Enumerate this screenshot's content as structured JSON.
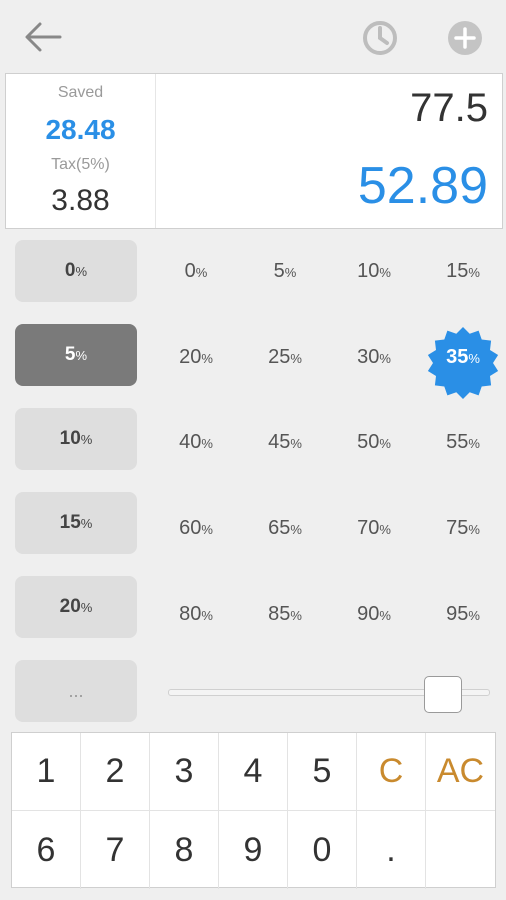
{
  "toolbar": {
    "back_icon": "arrow-left-icon",
    "history_icon": "clock-icon",
    "add_icon": "plus-circle-icon"
  },
  "summary": {
    "saved_label": "Saved",
    "saved_value": "28.48",
    "tax_label": "Tax(5%)",
    "tax_value": "3.88",
    "amount": "77.5",
    "total": "52.89"
  },
  "tax_presets": [
    {
      "num": "0",
      "pct": "%"
    },
    {
      "num": "5",
      "pct": "%"
    },
    {
      "num": "10",
      "pct": "%"
    },
    {
      "num": "15",
      "pct": "%"
    },
    {
      "num": "20",
      "pct": "%"
    }
  ],
  "tax_more_label": "...",
  "active_tax_index": 1,
  "discounts": [
    {
      "num": "0",
      "pct": "%"
    },
    {
      "num": "5",
      "pct": "%"
    },
    {
      "num": "10",
      "pct": "%"
    },
    {
      "num": "15",
      "pct": "%"
    },
    {
      "num": "20",
      "pct": "%"
    },
    {
      "num": "25",
      "pct": "%"
    },
    {
      "num": "30",
      "pct": "%"
    },
    {
      "num": "35",
      "pct": "%"
    },
    {
      "num": "40",
      "pct": "%"
    },
    {
      "num": "45",
      "pct": "%"
    },
    {
      "num": "50",
      "pct": "%"
    },
    {
      "num": "55",
      "pct": "%"
    },
    {
      "num": "60",
      "pct": "%"
    },
    {
      "num": "65",
      "pct": "%"
    },
    {
      "num": "70",
      "pct": "%"
    },
    {
      "num": "75",
      "pct": "%"
    },
    {
      "num": "80",
      "pct": "%"
    },
    {
      "num": "85",
      "pct": "%"
    },
    {
      "num": "90",
      "pct": "%"
    },
    {
      "num": "95",
      "pct": "%"
    }
  ],
  "selected_discount_index": 7,
  "slider_value_fraction": 0.9,
  "keypad": {
    "row1": [
      "1",
      "2",
      "3",
      "4",
      "5",
      "C",
      "AC"
    ],
    "row2": [
      "6",
      "7",
      "8",
      "9",
      "0",
      ".",
      ""
    ]
  },
  "colors": {
    "accent": "#2a8fe6",
    "clear_key": "#c98a2e",
    "active_preset": "#7a7a7a"
  }
}
